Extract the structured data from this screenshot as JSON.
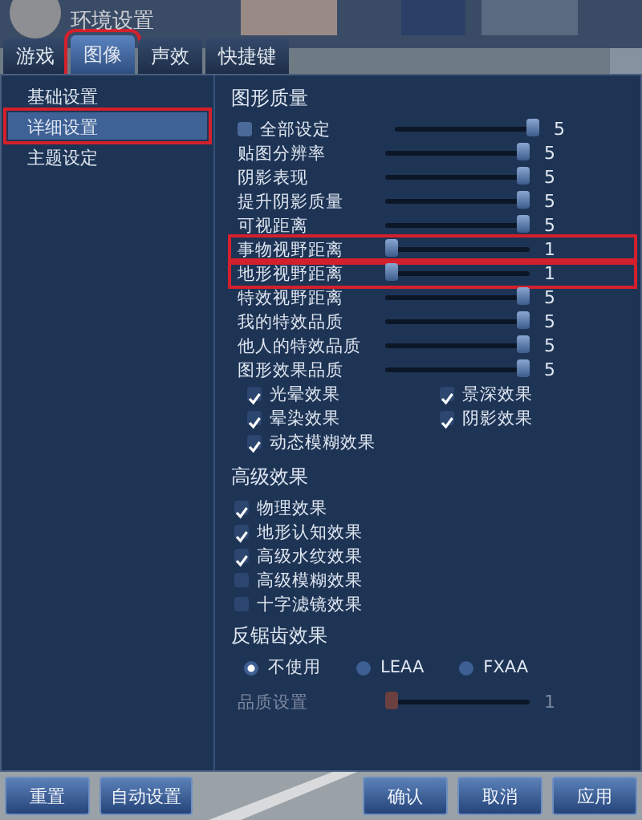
{
  "window": {
    "title": "环境设置"
  },
  "tabs": [
    {
      "label": "游戏",
      "selected": false,
      "highlighted": false
    },
    {
      "label": "图像",
      "selected": true,
      "highlighted": true
    },
    {
      "label": "声效",
      "selected": false,
      "highlighted": false
    },
    {
      "label": "快捷键",
      "selected": false,
      "highlighted": false
    }
  ],
  "sidebar": {
    "items": [
      {
        "label": "基础设置",
        "selected": false,
        "highlighted": false
      },
      {
        "label": "详细设置",
        "selected": true,
        "highlighted": true
      },
      {
        "label": "主题设定",
        "selected": false,
        "highlighted": false
      }
    ]
  },
  "graphics_quality": {
    "heading": "图形质量",
    "all_setting": {
      "label": "全部设定",
      "checked": false,
      "level": 1,
      "reading": "5"
    },
    "sliders": [
      {
        "label": "贴图分辨率",
        "level": 1,
        "reading": "5",
        "highlighted": false
      },
      {
        "label": "阴影表现",
        "level": 1,
        "reading": "5",
        "highlighted": false
      },
      {
        "label": "提升阴影质量",
        "level": 1,
        "reading": "5",
        "highlighted": false
      },
      {
        "label": "可视距离",
        "level": 1,
        "reading": "5",
        "highlighted": false
      },
      {
        "label": "事物视野距离",
        "level": 0,
        "reading": "1",
        "highlighted": true
      },
      {
        "label": "地形视野距离",
        "level": 0,
        "reading": "1",
        "highlighted": true
      },
      {
        "label": "特效视野距离",
        "level": 1,
        "reading": "5",
        "highlighted": false
      },
      {
        "label": "我的特效品质",
        "level": 1,
        "reading": "5",
        "highlighted": false
      },
      {
        "label": "他人的特效品质",
        "level": 1,
        "reading": "5",
        "highlighted": false
      },
      {
        "label": "图形效果品质",
        "level": 1,
        "reading": "5",
        "highlighted": false
      }
    ],
    "checkboxes": [
      {
        "label": "光晕效果",
        "checked": true
      },
      {
        "label": "景深效果",
        "checked": true
      },
      {
        "label": "晕染效果",
        "checked": true
      },
      {
        "label": "阴影效果",
        "checked": true
      },
      {
        "label": "动态模糊效果",
        "checked": true
      }
    ]
  },
  "advanced": {
    "heading": "高级效果",
    "checkboxes": [
      {
        "label": "物理效果",
        "checked": true
      },
      {
        "label": "地形认知效果",
        "checked": true
      },
      {
        "label": "高级水纹效果",
        "checked": true
      },
      {
        "label": "高级模糊效果",
        "checked": false
      },
      {
        "label": "十字滤镜效果",
        "checked": false
      }
    ]
  },
  "antialiasing": {
    "heading": "反锯齿效果",
    "options": [
      {
        "label": "不使用",
        "selected": true
      },
      {
        "label": "LEAA",
        "selected": false
      },
      {
        "label": "FXAA",
        "selected": false
      }
    ],
    "quality": {
      "label": "品质设置",
      "level": 0,
      "reading": "1",
      "disabled": true
    }
  },
  "buttons": {
    "left": [
      "重置",
      "自动设置"
    ],
    "right": [
      "确认",
      "取消",
      "应用"
    ]
  }
}
